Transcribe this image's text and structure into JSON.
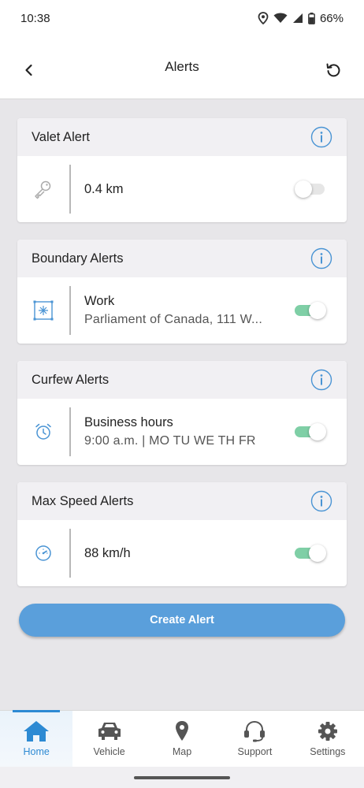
{
  "status_bar": {
    "time": "10:38",
    "battery": "66%"
  },
  "header": {
    "title": "Alerts"
  },
  "cards": [
    {
      "title": "Valet Alert",
      "icon": "key-icon",
      "primary": "0.4 km",
      "secondary": "",
      "toggle_on": false
    },
    {
      "title": "Boundary Alerts",
      "icon": "boundary-icon",
      "primary": "Work",
      "secondary": "Parliament of Canada, 111 W...",
      "toggle_on": true
    },
    {
      "title": "Curfew Alerts",
      "icon": "alarm-clock-icon",
      "primary": "Business hours",
      "secondary": "9:00 a.m. | MO TU WE TH FR",
      "toggle_on": true
    },
    {
      "title": "Max Speed Alerts",
      "icon": "speedometer-icon",
      "primary": "88 km/h",
      "secondary": "",
      "toggle_on": true
    }
  ],
  "create_button": {
    "label": "Create Alert"
  },
  "nav": {
    "items": [
      {
        "label": "Home",
        "icon": "home-icon",
        "active": true
      },
      {
        "label": "Vehicle",
        "icon": "car-icon",
        "active": false
      },
      {
        "label": "Map",
        "icon": "map-pin-icon",
        "active": false
      },
      {
        "label": "Support",
        "icon": "headset-icon",
        "active": false
      },
      {
        "label": "Settings",
        "icon": "gear-icon",
        "active": false
      }
    ]
  },
  "colors": {
    "accent": "#5a9fdb",
    "toggle_on": "#7fcfa6",
    "nav_active": "#2d8ad3",
    "info": "#4a94d4"
  }
}
